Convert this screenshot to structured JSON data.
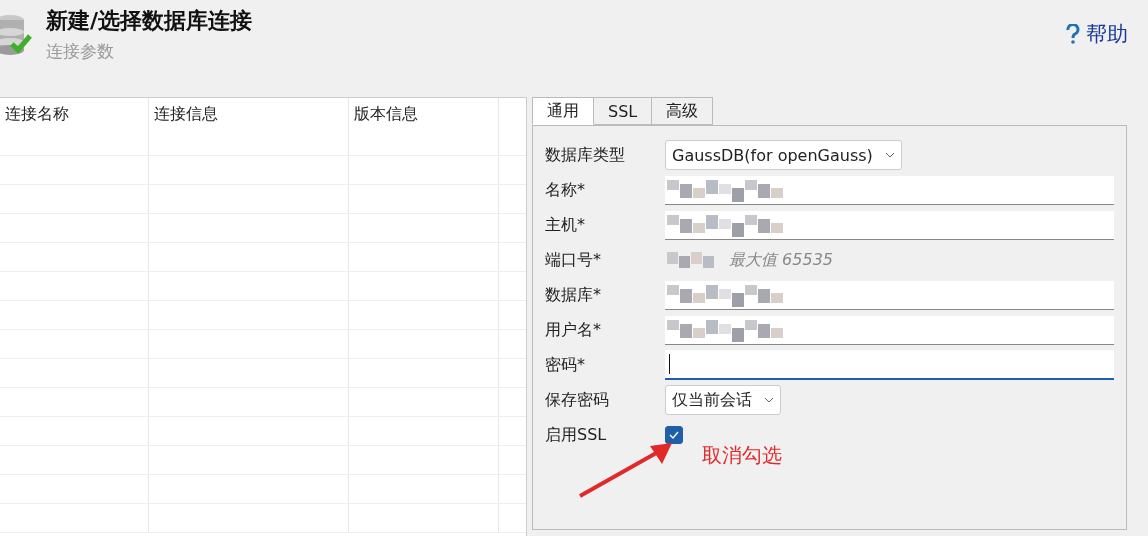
{
  "header": {
    "title": "新建/选择数据库连接",
    "subtitle": "连接参数",
    "help": "帮助"
  },
  "table": {
    "columns": [
      "连接名称",
      "连接信息",
      "版本信息"
    ]
  },
  "tabs": [
    {
      "label": "通用",
      "selected": true
    },
    {
      "label": "SSL",
      "selected": false
    },
    {
      "label": "高级",
      "selected": false
    }
  ],
  "form": [
    {
      "kind": "select",
      "label": "数据库类型",
      "value": "GaussDB(for openGauss)"
    },
    {
      "kind": "text",
      "label": "名称*",
      "blurred": true
    },
    {
      "kind": "text",
      "label": "主机*",
      "blurred": true
    },
    {
      "kind": "port",
      "label": "端口号*",
      "blurred": true,
      "placeholder": "最大值 65535"
    },
    {
      "kind": "text",
      "label": "数据库*",
      "blurred": true
    },
    {
      "kind": "text",
      "label": "用户名*",
      "blurred": true
    },
    {
      "kind": "text",
      "label": "密码*",
      "blurred": false,
      "focused": true
    },
    {
      "kind": "select",
      "label": "保存密码",
      "value": "仅当前会话"
    },
    {
      "kind": "checkbox",
      "label": "启用SSL",
      "checked": true
    }
  ],
  "annotation": {
    "text": "取消勾选"
  }
}
